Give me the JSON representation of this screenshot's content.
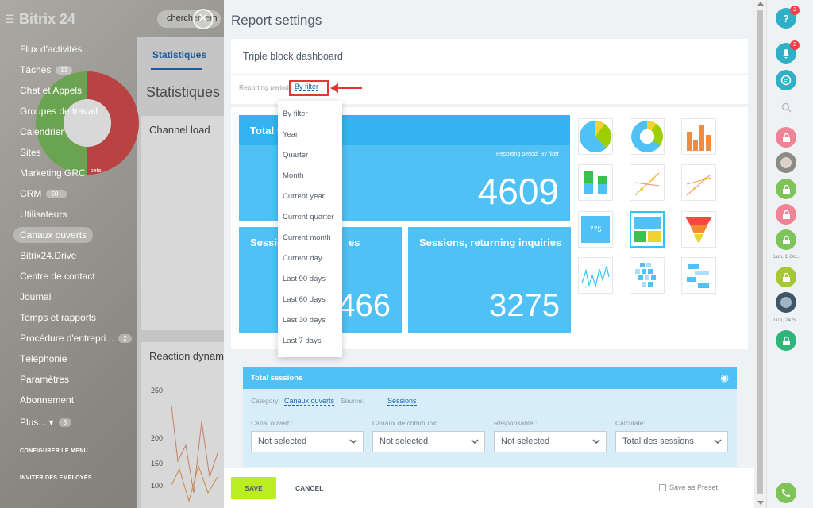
{
  "bg": {
    "logo": "Bitrix 24",
    "search_text": "chercher, em",
    "menu": [
      {
        "label": "Flux d'activités",
        "count": ""
      },
      {
        "label": "Tâches",
        "count": "13"
      },
      {
        "label": "Chat et Appels",
        "count": ""
      },
      {
        "label": "Groupes de travail",
        "count": ""
      },
      {
        "label": "Calendrier",
        "count": ""
      },
      {
        "label": "Sites",
        "count": ""
      },
      {
        "label": "Marketing GRC",
        "count": "beta"
      },
      {
        "label": "CRM",
        "count": "50+"
      },
      {
        "label": "Utilisateurs",
        "count": ""
      },
      {
        "label": "Canaux ouverts",
        "count": ""
      },
      {
        "label": "Bitrix24.Drive",
        "count": ""
      },
      {
        "label": "Centre de contact",
        "count": ""
      },
      {
        "label": "Journal",
        "count": ""
      },
      {
        "label": "Temps et rapports",
        "count": ""
      },
      {
        "label": "Procédure d'entrepri...",
        "count": "2"
      },
      {
        "label": "Téléphonie",
        "count": ""
      },
      {
        "label": "Paramètres",
        "count": ""
      },
      {
        "label": "Abonnement",
        "count": ""
      },
      {
        "label": "Plus... ▾",
        "count": "3"
      }
    ],
    "configure_menu": "CONFIGURER LE MENU",
    "invite": "INVITER DES EMPLOYÉS",
    "tab": "Statistiques",
    "heading": "Statistiques",
    "card1_title": "Channel load",
    "card2_title": "Reaction dynam",
    "axis_ticks": [
      "250",
      "200",
      "150",
      "100"
    ]
  },
  "panel": {
    "title": "Report settings",
    "report_name": "Triple block dashboard",
    "period_label": "Reporting period",
    "period_value": "By filter"
  },
  "board": {
    "tiles": [
      {
        "title": "Total s",
        "sub": "Reporting period: By filter",
        "value": "4609"
      },
      {
        "title": "Sessio",
        "title_right": "es",
        "value": "466"
      },
      {
        "title": "Sessions, returning inquiries",
        "value": "3275"
      }
    ],
    "thumb_label_775": "775"
  },
  "period_dropdown": {
    "options": [
      "By filter",
      "Year",
      "Quarter",
      "Month",
      "Current year",
      "Current quarter",
      "Current month",
      "Current day",
      "Last 90 days",
      "Last 60 days",
      "Last 30 days",
      "Last 7 days"
    ]
  },
  "config": {
    "title": "Total sessions",
    "category_label": "Category:",
    "category_value": "Canaux ouverts",
    "source_label": "Source:",
    "source_value": "Sessions",
    "fields": [
      {
        "label": "Canal ouvert :",
        "value": "Not selected"
      },
      {
        "label": "Canaux de communic...",
        "value": "Not selected"
      },
      {
        "label": "Responsable :",
        "value": "Not selected"
      },
      {
        "label": "Calculate:",
        "value": "Total des sessions"
      }
    ]
  },
  "footer": {
    "save": "SAVE",
    "cancel": "CANCEL",
    "preset": "Save as Preset"
  },
  "rightbar": {
    "help_badge": "2",
    "notif_badge": "2",
    "date1": "Lun, 1 Oc...",
    "date2": "Lun, 24 S..."
  },
  "colors": {
    "tile": "#4fc1f5",
    "save": "#bbed21",
    "link": "#2067b0",
    "highlight": "#e53535"
  }
}
